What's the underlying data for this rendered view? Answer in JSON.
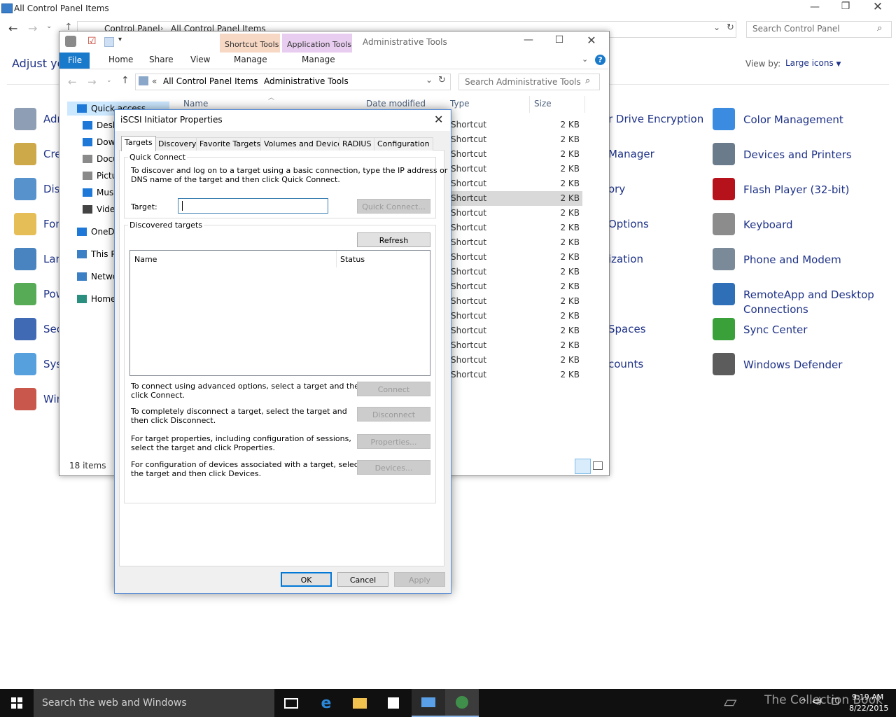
{
  "control_panel": {
    "title": "All Control Panel Items",
    "breadcrumb": [
      "Control Panel",
      "All Control Panel Items"
    ],
    "search_placeholder": "Search Control Panel",
    "heading": "Adjust your computer's settings",
    "heading_visible": "Adjust yo",
    "view_by_label": "View by:",
    "view_by_value": "Large icons",
    "left_items": [
      "Adm",
      "Cre",
      "Dis",
      "Fon",
      "Lan",
      "Pow",
      "Sec",
      "Sys",
      "Win"
    ],
    "mid_items": [
      "r Drive Encryption",
      "Manager",
      "ory",
      "Options",
      "ization",
      "Spaces",
      "counts"
    ],
    "right_items": [
      {
        "label": "Color Management",
        "icon": "color-management-icon",
        "color": "#3b8be0"
      },
      {
        "label": "Devices and Printers",
        "icon": "printer-icon",
        "color": "#6a7b8c"
      },
      {
        "label": "Flash Player (32-bit)",
        "icon": "flash-icon",
        "color": "#b5121b"
      },
      {
        "label": "Keyboard",
        "icon": "keyboard-icon",
        "color": "#8c8c8c"
      },
      {
        "label": "Phone and Modem",
        "icon": "phone-icon",
        "color": "#7a8a99"
      },
      {
        "label": "RemoteApp and Desktop",
        "label2": "Connections",
        "icon": "remoteapp-icon",
        "color": "#2f6fb7"
      },
      {
        "label": "Sync Center",
        "icon": "sync-icon",
        "color": "#3aa13a"
      },
      {
        "label": "Windows Defender",
        "icon": "defender-icon",
        "color": "#5c5c5c"
      }
    ]
  },
  "explorer": {
    "context_tabs": [
      "Shortcut Tools",
      "Application Tools"
    ],
    "window_title": "Administrative Tools",
    "ribbon_tabs": [
      "File",
      "Home",
      "Share",
      "View",
      "Manage",
      "Manage"
    ],
    "address": [
      "All Control Panel Items",
      "Administrative Tools"
    ],
    "address_prefix": "«",
    "search_placeholder": "Search Administrative Tools",
    "columns": [
      "Name",
      "Date modified",
      "Type",
      "Size"
    ],
    "nav": [
      "Quick access",
      "Desk",
      "Dow",
      "Docu",
      "Pictu",
      "Musi",
      "Vide",
      "OneDr",
      "This P",
      "Netwo",
      "Home"
    ],
    "rows_type": "Shortcut",
    "rows_size": "2 KB",
    "row_count": 18,
    "selected_row": 5,
    "status": "18 items"
  },
  "dialog": {
    "title": "iSCSI Initiator Properties",
    "tabs": [
      "Targets",
      "Discovery",
      "Favorite Targets",
      "Volumes and Devices",
      "RADIUS",
      "Configuration"
    ],
    "quick_connect_label": "Quick Connect",
    "quick_connect_desc1": "To discover and log on to a target using a basic connection, type the IP address or",
    "quick_connect_desc2": "DNS name of the target and then click Quick Connect.",
    "target_label": "Target:",
    "target_value": "",
    "quick_connect_button": "Quick Connect...",
    "discovered_label": "Discovered targets",
    "refresh_button": "Refresh",
    "list_columns": [
      "Name",
      "Status"
    ],
    "connect_desc1": "To connect using advanced options, select a target and then",
    "connect_desc2": "click Connect.",
    "connect_button": "Connect",
    "disconnect_desc1": "To completely disconnect a target, select the target and",
    "disconnect_desc2": "then click Disconnect.",
    "disconnect_button": "Disconnect",
    "properties_desc1": "For target properties, including configuration of sessions,",
    "properties_desc2": "select the target and click Properties.",
    "properties_button": "Properties...",
    "devices_desc1": "For configuration of devices associated with a target, select",
    "devices_desc2": "the target and then click Devices.",
    "devices_button": "Devices...",
    "ok": "OK",
    "cancel": "Cancel",
    "apply": "Apply"
  },
  "taskbar": {
    "search_placeholder": "Search the web and Windows",
    "time": "9:19 AM",
    "date": "8/22/2015",
    "watermark": "The Collection Book"
  }
}
